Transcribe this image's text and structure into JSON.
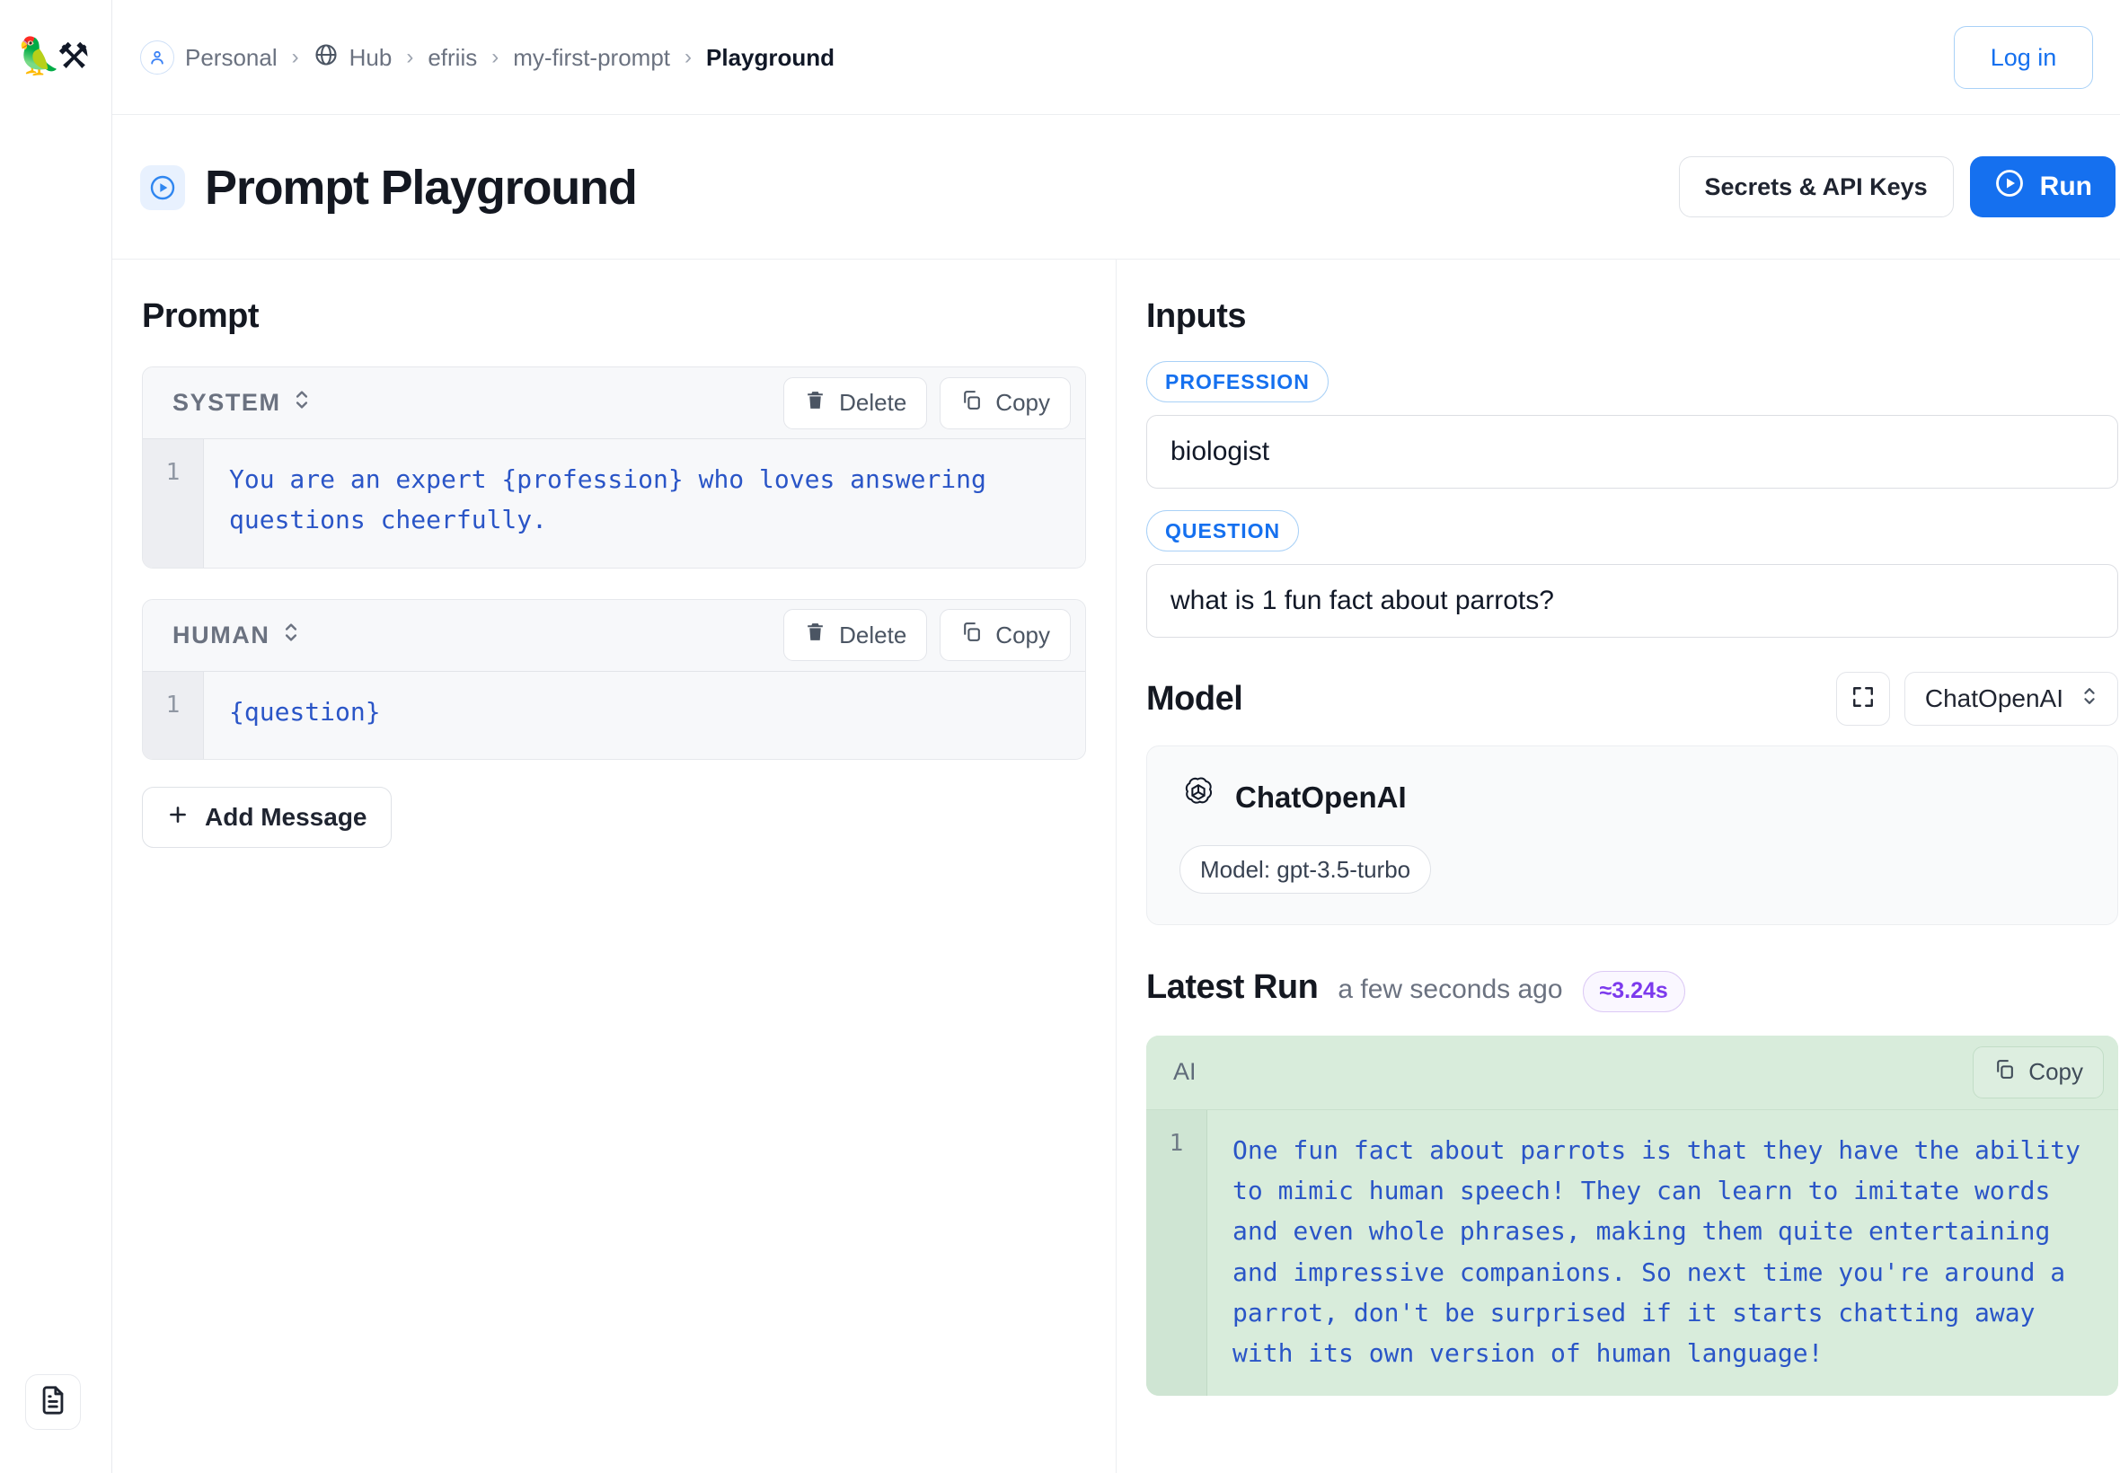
{
  "brand": {
    "logo_glyphs": "🦜⚒"
  },
  "breadcrumb": {
    "items": [
      {
        "label": "Personal",
        "icon": "user-icon",
        "active": false
      },
      {
        "label": "Hub",
        "icon": "globe-icon",
        "active": false
      },
      {
        "label": "efriis",
        "icon": "",
        "active": false
      },
      {
        "label": "my-first-prompt",
        "icon": "",
        "active": false
      },
      {
        "label": "Playground",
        "icon": "",
        "active": true
      }
    ],
    "separator": "›"
  },
  "topbar": {
    "login_label": "Log in"
  },
  "header": {
    "title": "Prompt Playground",
    "secrets_label": "Secrets & API Keys",
    "run_label": "Run"
  },
  "prompt": {
    "heading": "Prompt",
    "messages": [
      {
        "role": "SYSTEM",
        "delete_label": "Delete",
        "copy_label": "Copy",
        "line_no": "1",
        "content": "You are an expert {profession} who loves answering questions cheerfully."
      },
      {
        "role": "HUMAN",
        "delete_label": "Delete",
        "copy_label": "Copy",
        "line_no": "1",
        "content": "{question}"
      }
    ],
    "add_message_label": "Add Message"
  },
  "inputs": {
    "heading": "Inputs",
    "fields": [
      {
        "chip": "PROFESSION",
        "value": "biologist",
        "placeholder": ""
      },
      {
        "chip": "QUESTION",
        "value": "what is 1 fun fact about parrots?",
        "placeholder": ""
      }
    ]
  },
  "model": {
    "heading": "Model",
    "selected": "ChatOpenAI",
    "card_title": "ChatOpenAI",
    "model_pill": "Model: gpt-3.5-turbo"
  },
  "latest_run": {
    "heading": "Latest Run",
    "ago": "a few seconds ago",
    "duration": "≈3.24s",
    "output": {
      "role": "AI",
      "copy_label": "Copy",
      "line_no": "1",
      "text": "One fun fact about parrots is that they have the ability to mimic human speech! They can learn to imitate words and even whole phrases, making them quite entertaining and impressive companions. So next time you're around a parrot, don't be surprised if it starts chatting away with its own version of human language!"
    }
  },
  "colors": {
    "accent_blue": "#1570ef",
    "code_blue": "#2a55c7",
    "ai_green_bg": "#d8ecdb",
    "duration_purple": "#7c3aed"
  }
}
